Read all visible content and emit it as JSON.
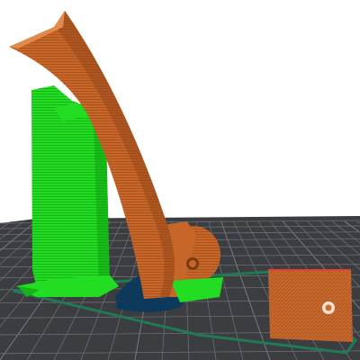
{
  "viewport": {
    "background": "#ffffff",
    "bed_color": "#3b3d40",
    "bed_grid_color": "#6b6e73",
    "bed_grid_major_color": "#858a90",
    "skirt_color": "#1f7a55",
    "support_color": "#22dd22",
    "support_shade": "#10a010",
    "perimeter_color": "#c8662a",
    "perimeter_shade": "#9a4a1a",
    "perimeter_highlight": "#e38a4a",
    "first_layer_color": "#0d3a5c",
    "edge_highlight": "#e04030"
  },
  "objects": [
    {
      "name": "curved-arm-part",
      "feature": "perimeter"
    },
    {
      "name": "support-tower",
      "feature": "support"
    },
    {
      "name": "hinge-mount-part",
      "feature": "perimeter"
    },
    {
      "name": "flat-plate-part",
      "feature": "perimeter"
    }
  ]
}
